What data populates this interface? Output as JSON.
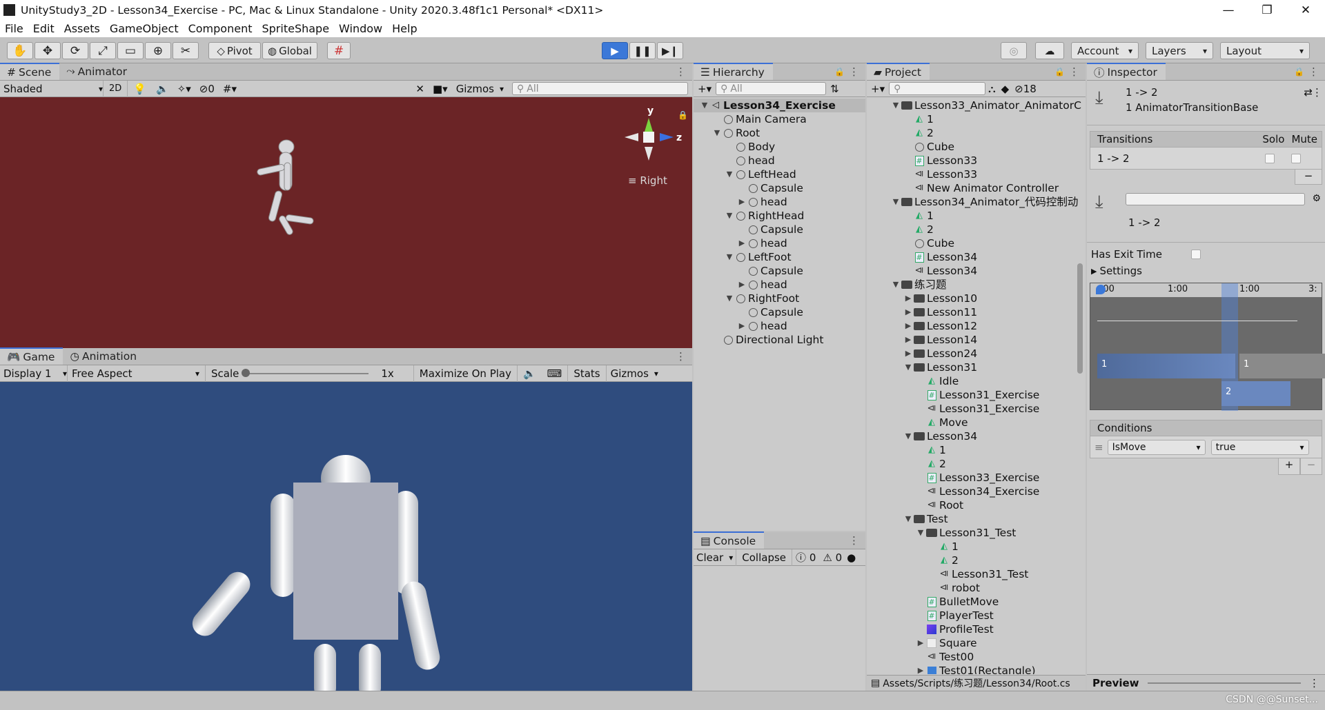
{
  "window": {
    "title": "UnityStudy3_2D - Lesson34_Exercise - PC, Mac & Linux Standalone - Unity 2020.3.48f1c1 Personal* <DX11>"
  },
  "menu": [
    "File",
    "Edit",
    "Assets",
    "GameObject",
    "Component",
    "SpriteShape",
    "Window",
    "Help"
  ],
  "toolbar": {
    "pivot": "Pivot",
    "global": "Global",
    "account": "Account",
    "layers": "Layers",
    "layout": "Layout"
  },
  "scene": {
    "tabs": [
      "Scene",
      "Animator"
    ],
    "shading": "Shaded",
    "mode2d": "2D",
    "hidden_count": "0",
    "gizmos": "Gizmos",
    "search_placeholder": "All",
    "gizmo_y": "y",
    "gizmo_z": "z",
    "view_label": "Right",
    "bg_color": "#6b2426"
  },
  "game": {
    "tabs": [
      "Game",
      "Animation"
    ],
    "display": "Display 1",
    "aspect": "Free Aspect",
    "scale_label": "Scale",
    "scale_value": "1x",
    "maximize": "Maximize On Play",
    "stats": "Stats",
    "gizmos": "Gizmos",
    "bg_color": "#2f4c7e"
  },
  "hierarchy": {
    "tab": "Hierarchy",
    "search_placeholder": "All",
    "items": [
      {
        "label": "Lesson34_Exercise",
        "depth": 0,
        "arrow": "▼",
        "icon": "scene",
        "bold": true
      },
      {
        "label": "Main Camera",
        "depth": 1,
        "arrow": "",
        "icon": "go"
      },
      {
        "label": "Root",
        "depth": 1,
        "arrow": "▼",
        "icon": "go"
      },
      {
        "label": "Body",
        "depth": 2,
        "arrow": "",
        "icon": "go"
      },
      {
        "label": "head",
        "depth": 2,
        "arrow": "",
        "icon": "go"
      },
      {
        "label": "LeftHead",
        "depth": 2,
        "arrow": "▼",
        "icon": "go"
      },
      {
        "label": "Capsule",
        "depth": 3,
        "arrow": "",
        "icon": "go"
      },
      {
        "label": "head",
        "depth": 3,
        "arrow": "▶",
        "icon": "go"
      },
      {
        "label": "RightHead",
        "depth": 2,
        "arrow": "▼",
        "icon": "go"
      },
      {
        "label": "Capsule",
        "depth": 3,
        "arrow": "",
        "icon": "go"
      },
      {
        "label": "head",
        "depth": 3,
        "arrow": "▶",
        "icon": "go"
      },
      {
        "label": "LeftFoot",
        "depth": 2,
        "arrow": "▼",
        "icon": "go"
      },
      {
        "label": "Capsule",
        "depth": 3,
        "arrow": "",
        "icon": "go"
      },
      {
        "label": "head",
        "depth": 3,
        "arrow": "▶",
        "icon": "go"
      },
      {
        "label": "RightFoot",
        "depth": 2,
        "arrow": "▼",
        "icon": "go"
      },
      {
        "label": "Capsule",
        "depth": 3,
        "arrow": "",
        "icon": "go"
      },
      {
        "label": "head",
        "depth": 3,
        "arrow": "▶",
        "icon": "go"
      },
      {
        "label": "Directional Light",
        "depth": 1,
        "arrow": "",
        "icon": "go"
      }
    ]
  },
  "console": {
    "tab": "Console",
    "clear": "Clear",
    "collapse": "Collapse",
    "warn_count": "0",
    "error_count": "0"
  },
  "project": {
    "tab": "Project",
    "hidden_count": "18",
    "path": "Assets/Scripts/练习题/Lesson34/Root.cs",
    "items": [
      {
        "label": "Lesson33_Animator_AnimatorC",
        "depth": 0,
        "arrow": "▼",
        "icon": "folder"
      },
      {
        "label": "1",
        "depth": 1,
        "arrow": "",
        "icon": "anim"
      },
      {
        "label": "2",
        "depth": 1,
        "arrow": "",
        "icon": "anim"
      },
      {
        "label": "Cube",
        "depth": 1,
        "arrow": "",
        "icon": "go"
      },
      {
        "label": "Lesson33",
        "depth": 1,
        "arrow": "",
        "icon": "script"
      },
      {
        "label": "Lesson33",
        "depth": 1,
        "arrow": "",
        "icon": "ctrl"
      },
      {
        "label": "New Animator Controller",
        "depth": 1,
        "arrow": "",
        "icon": "ctrl"
      },
      {
        "label": "Lesson34_Animator_代码控制动",
        "depth": 0,
        "arrow": "▼",
        "icon": "folder"
      },
      {
        "label": "1",
        "depth": 1,
        "arrow": "",
        "icon": "anim"
      },
      {
        "label": "2",
        "depth": 1,
        "arrow": "",
        "icon": "anim"
      },
      {
        "label": "Cube",
        "depth": 1,
        "arrow": "",
        "icon": "go"
      },
      {
        "label": "Lesson34",
        "depth": 1,
        "arrow": "",
        "icon": "script"
      },
      {
        "label": "Lesson34",
        "depth": 1,
        "arrow": "",
        "icon": "ctrl"
      },
      {
        "label": "练习题",
        "depth": 0,
        "arrow": "▼",
        "icon": "folder"
      },
      {
        "label": "Lesson10",
        "depth": 1,
        "arrow": "▶",
        "icon": "folder"
      },
      {
        "label": "Lesson11",
        "depth": 1,
        "arrow": "▶",
        "icon": "folder"
      },
      {
        "label": "Lesson12",
        "depth": 1,
        "arrow": "▶",
        "icon": "folder"
      },
      {
        "label": "Lesson14",
        "depth": 1,
        "arrow": "▶",
        "icon": "folder"
      },
      {
        "label": "Lesson24",
        "depth": 1,
        "arrow": "▶",
        "icon": "folder"
      },
      {
        "label": "Lesson31",
        "depth": 1,
        "arrow": "▼",
        "icon": "folder"
      },
      {
        "label": "Idle",
        "depth": 2,
        "arrow": "",
        "icon": "anim"
      },
      {
        "label": "Lesson31_Exercise",
        "depth": 2,
        "arrow": "",
        "icon": "script"
      },
      {
        "label": "Lesson31_Exercise",
        "depth": 2,
        "arrow": "",
        "icon": "ctrl"
      },
      {
        "label": "Move",
        "depth": 2,
        "arrow": "",
        "icon": "anim"
      },
      {
        "label": "Lesson34",
        "depth": 1,
        "arrow": "▼",
        "icon": "folder"
      },
      {
        "label": "1",
        "depth": 2,
        "arrow": "",
        "icon": "anim"
      },
      {
        "label": "2",
        "depth": 2,
        "arrow": "",
        "icon": "anim"
      },
      {
        "label": "Lesson33_Exercise",
        "depth": 2,
        "arrow": "",
        "icon": "script"
      },
      {
        "label": "Lesson34_Exercise",
        "depth": 2,
        "arrow": "",
        "icon": "ctrl"
      },
      {
        "label": "Root",
        "depth": 2,
        "arrow": "",
        "icon": "ctrl"
      },
      {
        "label": "Test",
        "depth": 1,
        "arrow": "▼",
        "icon": "folder"
      },
      {
        "label": "Lesson31_Test",
        "depth": 2,
        "arrow": "▼",
        "icon": "folder"
      },
      {
        "label": "1",
        "depth": 3,
        "arrow": "",
        "icon": "anim"
      },
      {
        "label": "2",
        "depth": 3,
        "arrow": "",
        "icon": "anim"
      },
      {
        "label": "Lesson31_Test",
        "depth": 3,
        "arrow": "",
        "icon": "ctrl"
      },
      {
        "label": "robot",
        "depth": 3,
        "arrow": "",
        "icon": "ctrl"
      },
      {
        "label": "BulletMove",
        "depth": 2,
        "arrow": "",
        "icon": "script"
      },
      {
        "label": "PlayerTest",
        "depth": 2,
        "arrow": "",
        "icon": "script"
      },
      {
        "label": "ProfileTest",
        "depth": 2,
        "arrow": "",
        "icon": "purple"
      },
      {
        "label": "Square",
        "depth": 2,
        "arrow": "▶",
        "icon": "sq"
      },
      {
        "label": "Test00",
        "depth": 2,
        "arrow": "",
        "icon": "ctrl"
      },
      {
        "label": "Test01(Rectangle)",
        "depth": 2,
        "arrow": "▶",
        "icon": "prefab"
      }
    ]
  },
  "inspector": {
    "tab": "Inspector",
    "title": "1 -> 2",
    "subtitle": "1 AnimatorTransitionBase",
    "transitions_header": "Transitions",
    "solo": "Solo",
    "mute": "Mute",
    "transition_row": "1 -> 2",
    "transition_name": "1 -> 2",
    "has_exit_time": "Has Exit Time",
    "settings": "Settings",
    "timeline_ticks": [
      ":00",
      "1:00",
      "1:00",
      "3:"
    ],
    "clip_a": "1",
    "clip_b": "1",
    "clip_c": "2",
    "conditions": "Conditions",
    "param": "IsMove",
    "value": "true",
    "preview": "Preview"
  },
  "watermark": "CSDN @@Sunset..."
}
